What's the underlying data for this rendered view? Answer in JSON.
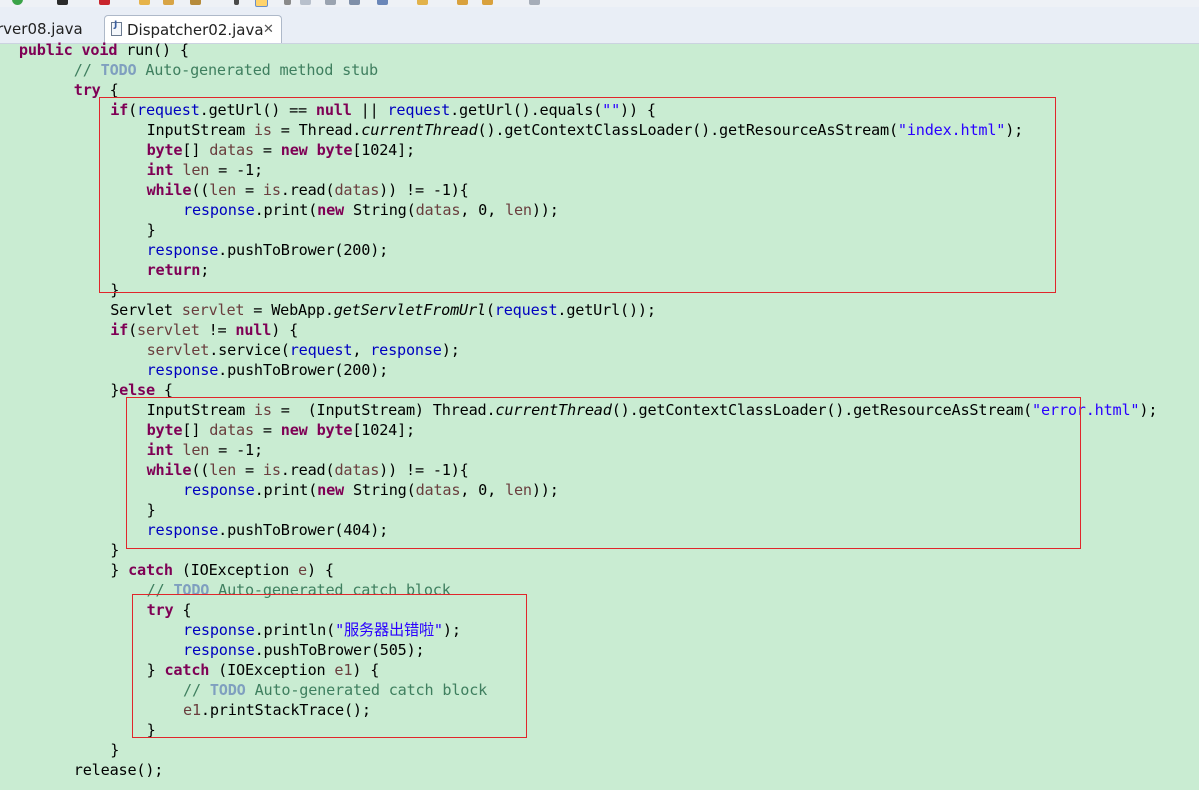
{
  "tabs": [
    {
      "label": "rver08.java",
      "active": false
    },
    {
      "label": "Dispatcher02.java",
      "active": true
    }
  ],
  "code": {
    "lines": [
      [
        [
          "  public void",
          "kw"
        ],
        [
          " run() {",
          ""
        ]
      ],
      [
        [
          "    ",
          ""
        ],
        [
          "// ",
          "com"
        ],
        [
          "TODO",
          "todo"
        ],
        [
          " Auto-generated method stub",
          "com"
        ]
      ],
      [
        [
          "    ",
          ""
        ],
        [
          "try",
          "kw"
        ],
        [
          " {",
          ""
        ]
      ],
      [
        [
          "      ",
          ""
        ],
        [
          "if",
          "kw"
        ],
        [
          "(",
          ""
        ],
        [
          "request",
          "fld"
        ],
        [
          ".getUrl() == ",
          ""
        ],
        [
          "null",
          "kw"
        ],
        [
          " || ",
          ""
        ],
        [
          "request",
          "fld"
        ],
        [
          ".getUrl().equals(",
          ""
        ],
        [
          "\"\"",
          "str"
        ],
        [
          ")) {",
          ""
        ]
      ],
      [
        [
          "        InputStream ",
          ""
        ],
        [
          "is",
          "lv"
        ],
        [
          " = Thread.",
          ""
        ],
        [
          "currentThread",
          "it"
        ],
        [
          "().getContextClassLoader().getResourceAsStream(",
          ""
        ],
        [
          "\"index.html\"",
          "str"
        ],
        [
          ");",
          ""
        ]
      ],
      [
        [
          "        ",
          ""
        ],
        [
          "byte",
          "kw"
        ],
        [
          "[] ",
          ""
        ],
        [
          "datas",
          "lv"
        ],
        [
          " = ",
          ""
        ],
        [
          "new",
          "kw"
        ],
        [
          " ",
          ""
        ],
        [
          "byte",
          "kw"
        ],
        [
          "[1024];",
          ""
        ]
      ],
      [
        [
          "        ",
          ""
        ],
        [
          "int",
          "kw"
        ],
        [
          " ",
          ""
        ],
        [
          "len",
          "lv"
        ],
        [
          " = -1;",
          ""
        ]
      ],
      [
        [
          "        ",
          ""
        ],
        [
          "while",
          "kw"
        ],
        [
          "((",
          ""
        ],
        [
          "len",
          "lv"
        ],
        [
          " = ",
          ""
        ],
        [
          "is",
          "lv"
        ],
        [
          ".read(",
          ""
        ],
        [
          "datas",
          "lv"
        ],
        [
          ")) != -1){",
          ""
        ]
      ],
      [
        [
          "          ",
          ""
        ],
        [
          "response",
          "fld"
        ],
        [
          ".print(",
          ""
        ],
        [
          "new",
          "kw"
        ],
        [
          " String(",
          ""
        ],
        [
          "datas",
          "lv"
        ],
        [
          ", 0, ",
          ""
        ],
        [
          "len",
          "lv"
        ],
        [
          "));",
          ""
        ]
      ],
      [
        [
          "        }",
          ""
        ]
      ],
      [
        [
          "        ",
          ""
        ],
        [
          "response",
          "fld"
        ],
        [
          ".pushToBrower(200);",
          ""
        ]
      ],
      [
        [
          "        ",
          ""
        ],
        [
          "return",
          "kw"
        ],
        [
          ";",
          ""
        ]
      ],
      [
        [
          "      }",
          ""
        ]
      ],
      [
        [
          "      Servlet ",
          ""
        ],
        [
          "servlet",
          "lv"
        ],
        [
          " = WebApp.",
          ""
        ],
        [
          "getServletFromUrl",
          "it"
        ],
        [
          "(",
          ""
        ],
        [
          "request",
          "fld"
        ],
        [
          ".getUrl());",
          ""
        ]
      ],
      [
        [
          "      ",
          ""
        ],
        [
          "if",
          "kw"
        ],
        [
          "(",
          ""
        ],
        [
          "servlet",
          "lv"
        ],
        [
          " != ",
          ""
        ],
        [
          "null",
          "kw"
        ],
        [
          ") {",
          ""
        ]
      ],
      [
        [
          "        ",
          ""
        ],
        [
          "servlet",
          "lv"
        ],
        [
          ".service(",
          ""
        ],
        [
          "request",
          "fld"
        ],
        [
          ", ",
          ""
        ],
        [
          "response",
          "fld"
        ],
        [
          ");",
          ""
        ]
      ],
      [
        [
          "        ",
          ""
        ],
        [
          "response",
          "fld"
        ],
        [
          ".pushToBrower(200);",
          ""
        ]
      ],
      [
        [
          "      }",
          ""
        ],
        [
          "else",
          "kw"
        ],
        [
          " {",
          ""
        ]
      ],
      [
        [
          "        InputStream ",
          ""
        ],
        [
          "is",
          "lv"
        ],
        [
          " =  (InputStream) Thread.",
          ""
        ],
        [
          "currentThread",
          "it"
        ],
        [
          "().getContextClassLoader().getResourceAsStream(",
          ""
        ],
        [
          "\"error.html\"",
          "str"
        ],
        [
          ");",
          ""
        ]
      ],
      [
        [
          "        ",
          ""
        ],
        [
          "byte",
          "kw"
        ],
        [
          "[] ",
          ""
        ],
        [
          "datas",
          "lv"
        ],
        [
          " = ",
          ""
        ],
        [
          "new",
          "kw"
        ],
        [
          " ",
          ""
        ],
        [
          "byte",
          "kw"
        ],
        [
          "[1024];",
          ""
        ]
      ],
      [
        [
          "        ",
          ""
        ],
        [
          "int",
          "kw"
        ],
        [
          " ",
          ""
        ],
        [
          "len",
          "lv"
        ],
        [
          " = -1;",
          ""
        ]
      ],
      [
        [
          "        ",
          ""
        ],
        [
          "while",
          "kw"
        ],
        [
          "((",
          ""
        ],
        [
          "len",
          "lv"
        ],
        [
          " = ",
          ""
        ],
        [
          "is",
          "lv"
        ],
        [
          ".read(",
          ""
        ],
        [
          "datas",
          "lv"
        ],
        [
          ")) != -1){",
          ""
        ]
      ],
      [
        [
          "          ",
          ""
        ],
        [
          "response",
          "fld"
        ],
        [
          ".print(",
          ""
        ],
        [
          "new",
          "kw"
        ],
        [
          " String(",
          ""
        ],
        [
          "datas",
          "lv"
        ],
        [
          ", 0, ",
          ""
        ],
        [
          "len",
          "lv"
        ],
        [
          "));",
          ""
        ]
      ],
      [
        [
          "        }",
          ""
        ]
      ],
      [
        [
          "        ",
          ""
        ],
        [
          "response",
          "fld"
        ],
        [
          ".pushToBrower(404);",
          ""
        ]
      ],
      [
        [
          "      }",
          ""
        ]
      ],
      [
        [
          "      } ",
          ""
        ],
        [
          "catch",
          "kw"
        ],
        [
          " (IOException ",
          ""
        ],
        [
          "e",
          "lv"
        ],
        [
          ") {",
          ""
        ]
      ],
      [
        [
          "        ",
          ""
        ],
        [
          "// ",
          "com"
        ],
        [
          "TODO",
          "todo"
        ],
        [
          " Auto-generated catch block",
          "com"
        ]
      ],
      [
        [
          "        ",
          ""
        ],
        [
          "try",
          "kw"
        ],
        [
          " {",
          ""
        ]
      ],
      [
        [
          "          ",
          ""
        ],
        [
          "response",
          "fld"
        ],
        [
          ".println(",
          ""
        ],
        [
          "\"服务器出错啦\"",
          "str"
        ],
        [
          ");",
          ""
        ]
      ],
      [
        [
          "          ",
          ""
        ],
        [
          "response",
          "fld"
        ],
        [
          ".pushToBrower(505);",
          ""
        ]
      ],
      [
        [
          "        } ",
          ""
        ],
        [
          "catch",
          "kw"
        ],
        [
          " (IOException ",
          ""
        ],
        [
          "e1",
          "lv"
        ],
        [
          ") {",
          ""
        ]
      ],
      [
        [
          "          ",
          ""
        ],
        [
          "// ",
          "com"
        ],
        [
          "TODO",
          "todo"
        ],
        [
          " Auto-generated catch block",
          "com"
        ]
      ],
      [
        [
          "          ",
          ""
        ],
        [
          "e1",
          "lv"
        ],
        [
          ".printStackTrace();",
          ""
        ]
      ],
      [
        [
          "        }",
          ""
        ]
      ],
      [
        [
          "      }",
          ""
        ]
      ],
      [
        [
          "    release();",
          ""
        ]
      ]
    ]
  },
  "colors": {
    "editor_background": "#c9ecd2",
    "keyword": "#7f0055",
    "field": "#0000c0",
    "string": "#2a00ff",
    "comment": "#3f7f5f",
    "annotation_box": "#e0262b"
  }
}
